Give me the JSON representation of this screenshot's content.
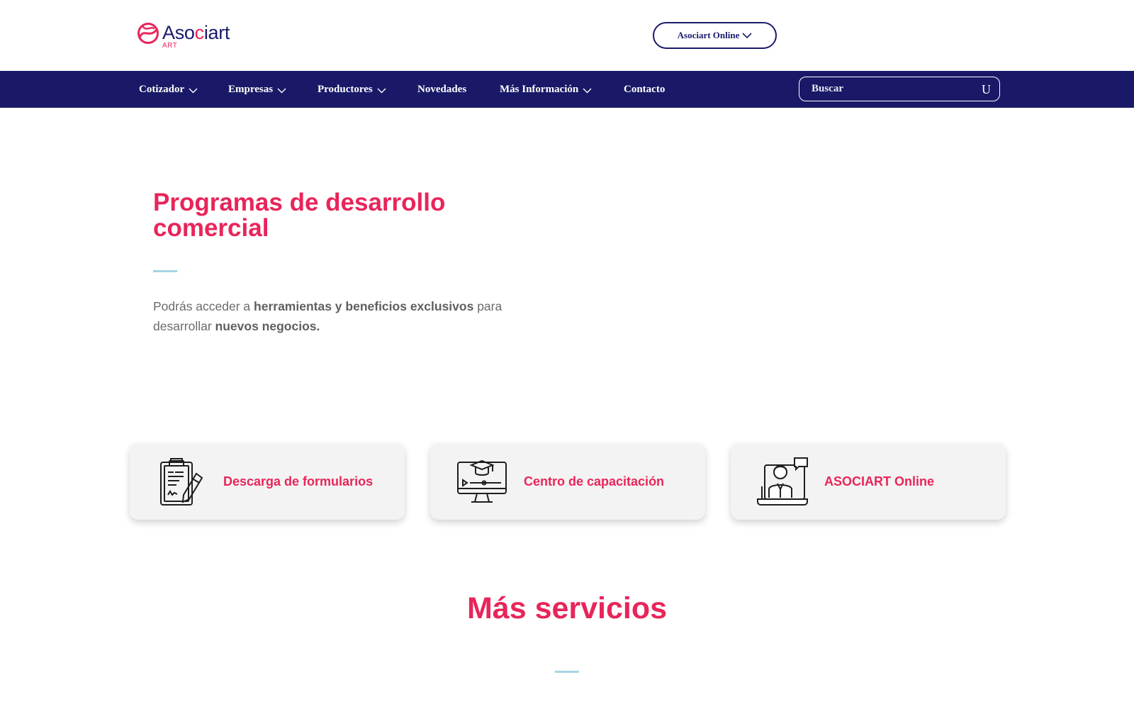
{
  "brand": {
    "name_part1": "Aso",
    "name_o": "c",
    "name_part2": "iart",
    "subtitle": "ART",
    "primary_color": "#1a1a6c",
    "accent_color": "#e8255a"
  },
  "header": {
    "online_button_label": "Asociart Online"
  },
  "nav": {
    "items": [
      {
        "label": "Cotizador",
        "has_dropdown": true
      },
      {
        "label": "Empresas",
        "has_dropdown": true
      },
      {
        "label": "Productores",
        "has_dropdown": true
      },
      {
        "label": "Novedades",
        "has_dropdown": false
      },
      {
        "label": "Más Información",
        "has_dropdown": true
      },
      {
        "label": "Contacto",
        "has_dropdown": false
      }
    ],
    "search_placeholder": "Buscar",
    "search_icon_glyph": "U"
  },
  "hero": {
    "title": "Programas de desarrollo comercial",
    "text_part1": "Podrás acceder a ",
    "text_bold1": "herramientas y beneficios exclusivos",
    "text_part2": " para desarrollar ",
    "text_bold2": "nuevos negocios."
  },
  "cards": [
    {
      "label": "Descarga de formularios",
      "icon": "clipboard-form-icon"
    },
    {
      "label": "Centro de capacitación",
      "icon": "online-training-monitor-icon"
    },
    {
      "label": "ASOCIART Online",
      "icon": "online-consultant-icon"
    }
  ],
  "more_services": {
    "title": "Más servicios"
  }
}
